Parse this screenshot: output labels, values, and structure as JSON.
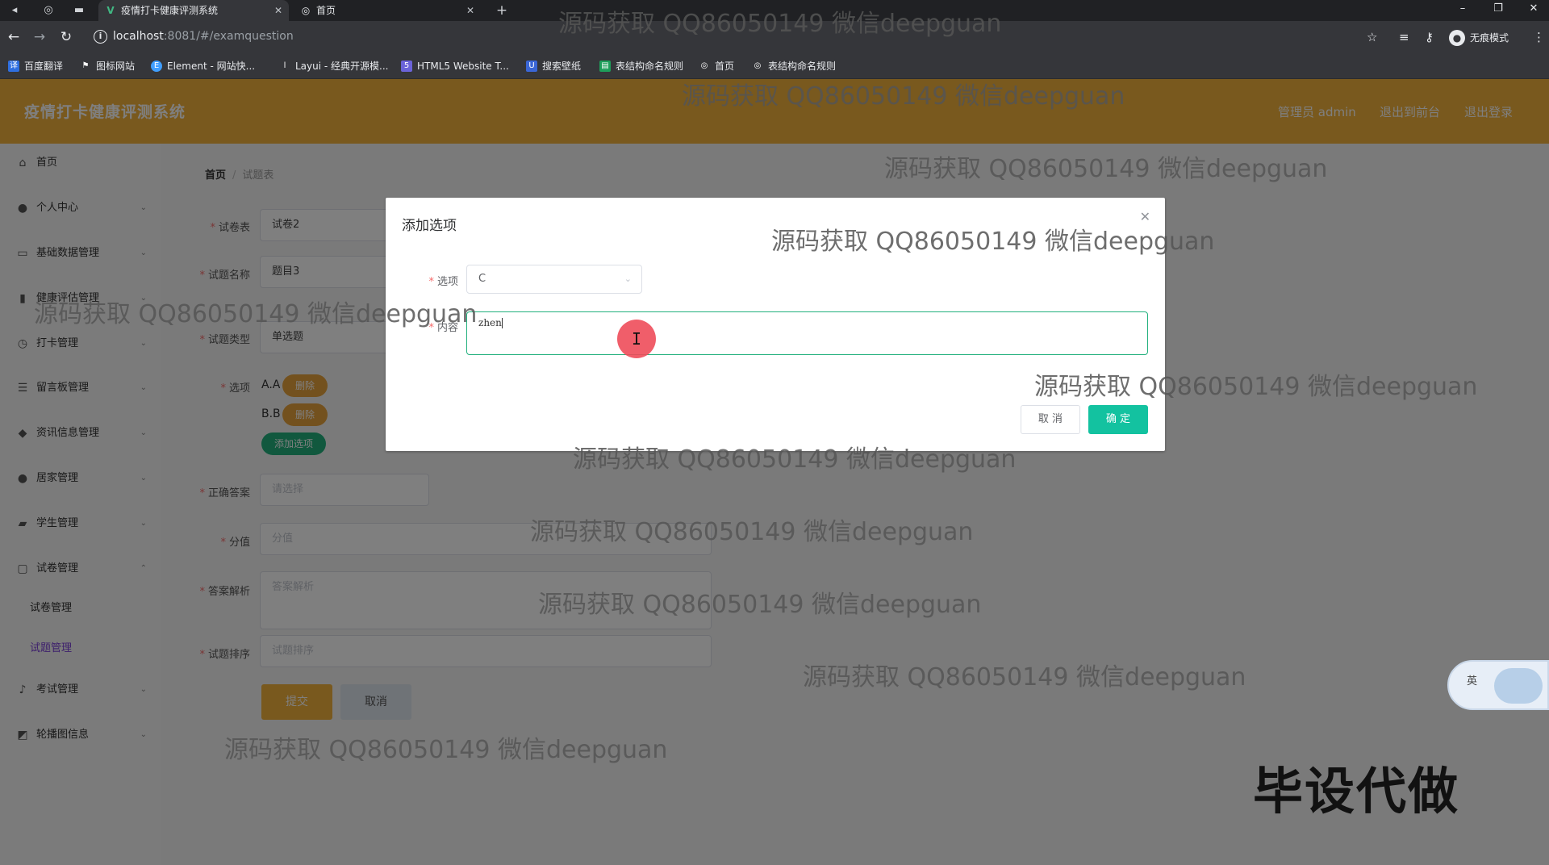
{
  "browser": {
    "tabs": [
      {
        "title": "疫情打卡健康评测系统",
        "active": true
      },
      {
        "title": "首页",
        "active": false
      }
    ],
    "url_host": "localhost",
    "url_rest": ":8081/#/examquestion",
    "incognito_label": "无痕模式",
    "bookmarks": [
      "百度翻译",
      "图标网站",
      "Element - 网站快...",
      "Layui - 经典开源模...",
      "HTML5 Website T...",
      "搜索壁纸",
      "表结构命名规则",
      "首页",
      "表结构命名规则"
    ]
  },
  "header": {
    "title": "疫情打卡健康评测系统",
    "links": [
      "管理员 admin",
      "退出到前台",
      "退出登录"
    ]
  },
  "sidebar": {
    "items": [
      {
        "label": "首页",
        "icon": "home-icon"
      },
      {
        "label": "个人中心",
        "icon": "user-icon"
      },
      {
        "label": "基础数据管理",
        "icon": "database-icon"
      },
      {
        "label": "健康评估管理",
        "icon": "chart-icon"
      },
      {
        "label": "打卡管理",
        "icon": "clock-icon"
      },
      {
        "label": "留言板管理",
        "icon": "list-icon"
      },
      {
        "label": "资讯信息管理",
        "icon": "info-icon"
      },
      {
        "label": "居家管理",
        "icon": "person-icon"
      },
      {
        "label": "学生管理",
        "icon": "student-icon"
      },
      {
        "label": "试卷管理",
        "icon": "paper-icon"
      }
    ],
    "subitems": [
      {
        "label": "试卷管理",
        "active": false
      },
      {
        "label": "试题管理",
        "active": true
      }
    ],
    "items_after": [
      {
        "label": "考试管理",
        "icon": "mic-icon"
      },
      {
        "label": "轮播图信息",
        "icon": "image-icon"
      }
    ]
  },
  "breadcrumb": {
    "home": "首页",
    "current": "试题表"
  },
  "form": {
    "paper_label": "试卷表",
    "paper_value": "试卷2",
    "name_label": "试题名称",
    "name_value": "题目3",
    "type_label": "试题类型",
    "type_value": "单选题",
    "options_label": "选项",
    "options": [
      {
        "text": "A.A",
        "button": "删除"
      },
      {
        "text": "B.B",
        "button": "删除"
      }
    ],
    "add_option_button": "添加选项",
    "answer_label": "正确答案",
    "answer_placeholder": "请选择",
    "score_label": "分值",
    "score_placeholder": "分值",
    "analysis_label": "答案解析",
    "analysis_placeholder": "答案解析",
    "order_label": "试题排序",
    "order_placeholder": "试题排序",
    "submit_button": "提交",
    "cancel_button": "取消"
  },
  "dialog": {
    "title": "添加选项",
    "option_label": "选项",
    "option_value": "C",
    "content_label": "内容",
    "content_value": "zhen",
    "cancel_button": "取 消",
    "confirm_button": "确 定"
  },
  "ime": {
    "lang": "英"
  },
  "watermark": "源码获取 QQ86050149 微信deepguan",
  "badge": "毕设代做",
  "colors": {
    "header": "#f3b23c",
    "primary_green": "#13c2a0",
    "danger": "#e6a23c",
    "active_menu": "#7b3fd8"
  }
}
